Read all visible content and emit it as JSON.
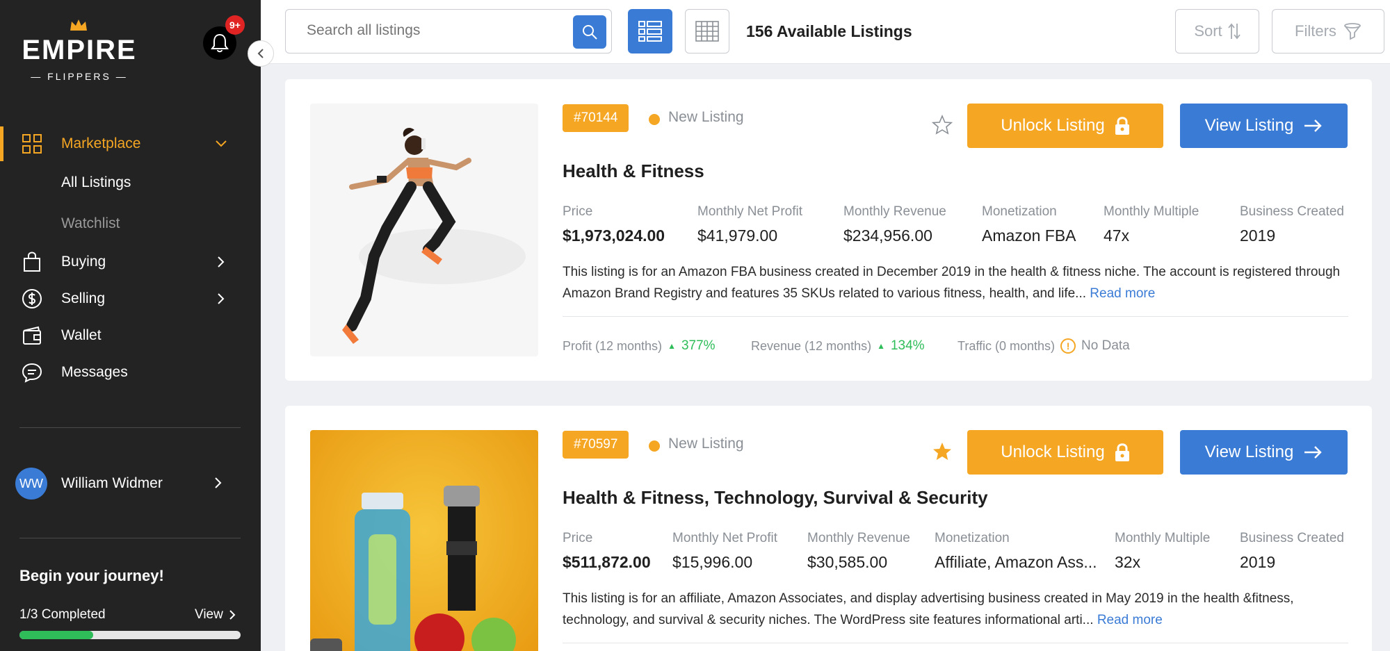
{
  "brand": {
    "name_line1": "EMPIRE",
    "name_line2": "— FLIPPERS —",
    "accent_color": "#f5a623",
    "primary_color": "#3a7bd5"
  },
  "notifications": {
    "badge": "9+"
  },
  "sidebar": {
    "marketplace_label": "Marketplace",
    "sub_items": [
      {
        "label": "All Listings"
      },
      {
        "label": "Watchlist"
      }
    ],
    "items": [
      {
        "label": "Buying",
        "icon": "shopping-bag-icon"
      },
      {
        "label": "Selling",
        "icon": "dollar-circle-icon"
      },
      {
        "label": "Wallet",
        "icon": "wallet-icon"
      },
      {
        "label": "Messages",
        "icon": "chat-icon"
      }
    ],
    "user": {
      "initials": "WW",
      "name": "William Widmer"
    },
    "journey": {
      "title": "Begin your journey!",
      "progress_text": "1/3 Completed",
      "view_label": "View",
      "progress_fraction": 0.333
    }
  },
  "topbar": {
    "search_placeholder": "Search all listings",
    "count_label": "156 Available Listings",
    "sort_label": "Sort",
    "filters_label": "Filters"
  },
  "listings": [
    {
      "id": "#70144",
      "status": "New Listing",
      "starred": false,
      "unlock_label": "Unlock Listing",
      "view_label": "View Listing",
      "title": "Health & Fitness",
      "stats": [
        {
          "label": "Price",
          "value": "$1,973,024.00"
        },
        {
          "label": "Monthly Net Profit",
          "value": "$41,979.00"
        },
        {
          "label": "Monthly Revenue",
          "value": "$234,956.00"
        },
        {
          "label": "Monetization",
          "value": "Amazon FBA"
        },
        {
          "label": "Monthly Multiple",
          "value": "47x"
        },
        {
          "label": "Business Created",
          "value": "2019"
        }
      ],
      "description": "This listing is for an Amazon FBA business created in December 2019 in the health & fitness niche. The account is registered through Amazon Brand Registry and features 35 SKUs related to various fitness, health, and life...",
      "read_more": "Read more",
      "metrics": {
        "profit_label": "Profit (12 months)",
        "profit_value": "377%",
        "revenue_label": "Revenue (12 months)",
        "revenue_value": "134%",
        "traffic_label": "Traffic (0 months)",
        "traffic_value": "No Data"
      }
    },
    {
      "id": "#70597",
      "status": "New Listing",
      "starred": true,
      "unlock_label": "Unlock Listing",
      "view_label": "View Listing",
      "title": "Health & Fitness, Technology, Survival & Security",
      "stats": [
        {
          "label": "Price",
          "value": "$511,872.00"
        },
        {
          "label": "Monthly Net Profit",
          "value": "$15,996.00"
        },
        {
          "label": "Monthly Revenue",
          "value": "$30,585.00"
        },
        {
          "label": "Monetization",
          "value": "Affiliate, Amazon Ass..."
        },
        {
          "label": "Monthly Multiple",
          "value": "32x"
        },
        {
          "label": "Business Created",
          "value": "2019"
        }
      ],
      "description": "This listing is for an affiliate, Amazon Associates, and display advertising business created in May 2019 in the health &fitness, technology, and survival & security niches. The WordPress site features informational arti...",
      "read_more": "Read more"
    }
  ]
}
